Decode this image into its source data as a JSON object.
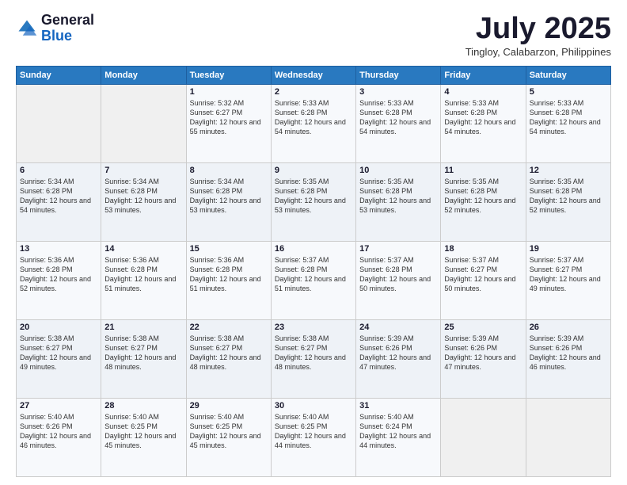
{
  "logo": {
    "general": "General",
    "blue": "Blue"
  },
  "header": {
    "month": "July 2025",
    "location": "Tingloy, Calabarzon, Philippines"
  },
  "days_of_week": [
    "Sunday",
    "Monday",
    "Tuesday",
    "Wednesday",
    "Thursday",
    "Friday",
    "Saturday"
  ],
  "weeks": [
    [
      {
        "day": "",
        "info": ""
      },
      {
        "day": "",
        "info": ""
      },
      {
        "day": "1",
        "info": "Sunrise: 5:32 AM\nSunset: 6:27 PM\nDaylight: 12 hours and 55 minutes."
      },
      {
        "day": "2",
        "info": "Sunrise: 5:33 AM\nSunset: 6:28 PM\nDaylight: 12 hours and 54 minutes."
      },
      {
        "day": "3",
        "info": "Sunrise: 5:33 AM\nSunset: 6:28 PM\nDaylight: 12 hours and 54 minutes."
      },
      {
        "day": "4",
        "info": "Sunrise: 5:33 AM\nSunset: 6:28 PM\nDaylight: 12 hours and 54 minutes."
      },
      {
        "day": "5",
        "info": "Sunrise: 5:33 AM\nSunset: 6:28 PM\nDaylight: 12 hours and 54 minutes."
      }
    ],
    [
      {
        "day": "6",
        "info": "Sunrise: 5:34 AM\nSunset: 6:28 PM\nDaylight: 12 hours and 54 minutes."
      },
      {
        "day": "7",
        "info": "Sunrise: 5:34 AM\nSunset: 6:28 PM\nDaylight: 12 hours and 53 minutes."
      },
      {
        "day": "8",
        "info": "Sunrise: 5:34 AM\nSunset: 6:28 PM\nDaylight: 12 hours and 53 minutes."
      },
      {
        "day": "9",
        "info": "Sunrise: 5:35 AM\nSunset: 6:28 PM\nDaylight: 12 hours and 53 minutes."
      },
      {
        "day": "10",
        "info": "Sunrise: 5:35 AM\nSunset: 6:28 PM\nDaylight: 12 hours and 53 minutes."
      },
      {
        "day": "11",
        "info": "Sunrise: 5:35 AM\nSunset: 6:28 PM\nDaylight: 12 hours and 52 minutes."
      },
      {
        "day": "12",
        "info": "Sunrise: 5:35 AM\nSunset: 6:28 PM\nDaylight: 12 hours and 52 minutes."
      }
    ],
    [
      {
        "day": "13",
        "info": "Sunrise: 5:36 AM\nSunset: 6:28 PM\nDaylight: 12 hours and 52 minutes."
      },
      {
        "day": "14",
        "info": "Sunrise: 5:36 AM\nSunset: 6:28 PM\nDaylight: 12 hours and 51 minutes."
      },
      {
        "day": "15",
        "info": "Sunrise: 5:36 AM\nSunset: 6:28 PM\nDaylight: 12 hours and 51 minutes."
      },
      {
        "day": "16",
        "info": "Sunrise: 5:37 AM\nSunset: 6:28 PM\nDaylight: 12 hours and 51 minutes."
      },
      {
        "day": "17",
        "info": "Sunrise: 5:37 AM\nSunset: 6:28 PM\nDaylight: 12 hours and 50 minutes."
      },
      {
        "day": "18",
        "info": "Sunrise: 5:37 AM\nSunset: 6:27 PM\nDaylight: 12 hours and 50 minutes."
      },
      {
        "day": "19",
        "info": "Sunrise: 5:37 AM\nSunset: 6:27 PM\nDaylight: 12 hours and 49 minutes."
      }
    ],
    [
      {
        "day": "20",
        "info": "Sunrise: 5:38 AM\nSunset: 6:27 PM\nDaylight: 12 hours and 49 minutes."
      },
      {
        "day": "21",
        "info": "Sunrise: 5:38 AM\nSunset: 6:27 PM\nDaylight: 12 hours and 48 minutes."
      },
      {
        "day": "22",
        "info": "Sunrise: 5:38 AM\nSunset: 6:27 PM\nDaylight: 12 hours and 48 minutes."
      },
      {
        "day": "23",
        "info": "Sunrise: 5:38 AM\nSunset: 6:27 PM\nDaylight: 12 hours and 48 minutes."
      },
      {
        "day": "24",
        "info": "Sunrise: 5:39 AM\nSunset: 6:26 PM\nDaylight: 12 hours and 47 minutes."
      },
      {
        "day": "25",
        "info": "Sunrise: 5:39 AM\nSunset: 6:26 PM\nDaylight: 12 hours and 47 minutes."
      },
      {
        "day": "26",
        "info": "Sunrise: 5:39 AM\nSunset: 6:26 PM\nDaylight: 12 hours and 46 minutes."
      }
    ],
    [
      {
        "day": "27",
        "info": "Sunrise: 5:40 AM\nSunset: 6:26 PM\nDaylight: 12 hours and 46 minutes."
      },
      {
        "day": "28",
        "info": "Sunrise: 5:40 AM\nSunset: 6:25 PM\nDaylight: 12 hours and 45 minutes."
      },
      {
        "day": "29",
        "info": "Sunrise: 5:40 AM\nSunset: 6:25 PM\nDaylight: 12 hours and 45 minutes."
      },
      {
        "day": "30",
        "info": "Sunrise: 5:40 AM\nSunset: 6:25 PM\nDaylight: 12 hours and 44 minutes."
      },
      {
        "day": "31",
        "info": "Sunrise: 5:40 AM\nSunset: 6:24 PM\nDaylight: 12 hours and 44 minutes."
      },
      {
        "day": "",
        "info": ""
      },
      {
        "day": "",
        "info": ""
      }
    ]
  ]
}
